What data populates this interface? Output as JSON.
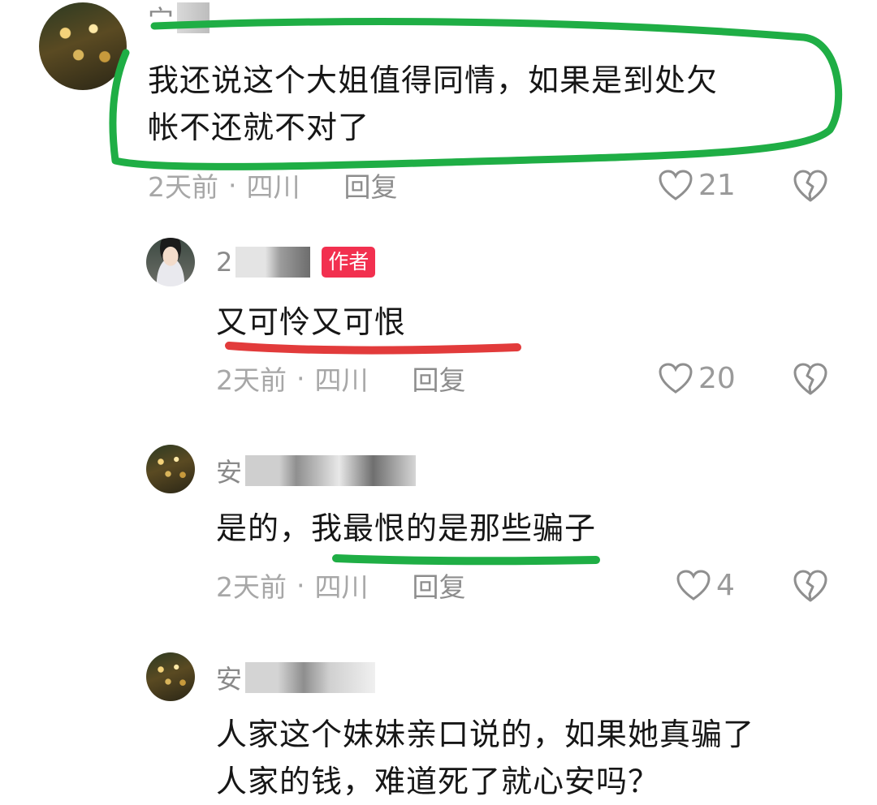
{
  "colors": {
    "highlight_green": "#1fae45",
    "highlight_red": "#e23b3b",
    "author_badge": "#f2304f",
    "meta_gray": "#a7a7a7"
  },
  "comments": [
    {
      "name_prefix": "宀",
      "text_lines": [
        "我还说这个大姐值得同情，如果是到处欠",
        "帐不还就不对了"
      ],
      "time": "2天前",
      "location": "四川",
      "reply_label": "回复",
      "likes": "21",
      "like_icon": "heart-icon",
      "dislike_icon": "broken-heart-icon"
    },
    {
      "name_prefix": "2",
      "badge": "作者",
      "text_lines": [
        "又可怜又可恨"
      ],
      "time": "2天前",
      "location": "四川",
      "reply_label": "回复",
      "likes": "20",
      "like_icon": "heart-icon",
      "dislike_icon": "broken-heart-icon"
    },
    {
      "name_prefix": "安",
      "text_lines": [
        "是的，我最恨的是那些骗子"
      ],
      "time": "2天前",
      "location": "四川",
      "reply_label": "回复",
      "likes": "4",
      "like_icon": "heart-icon",
      "dislike_icon": "broken-heart-icon"
    },
    {
      "name_prefix": "安",
      "text_lines": [
        "人家这个妹妹亲口说的，如果她真骗了",
        "人家的钱，难道死了就心安吗？"
      ]
    }
  ]
}
